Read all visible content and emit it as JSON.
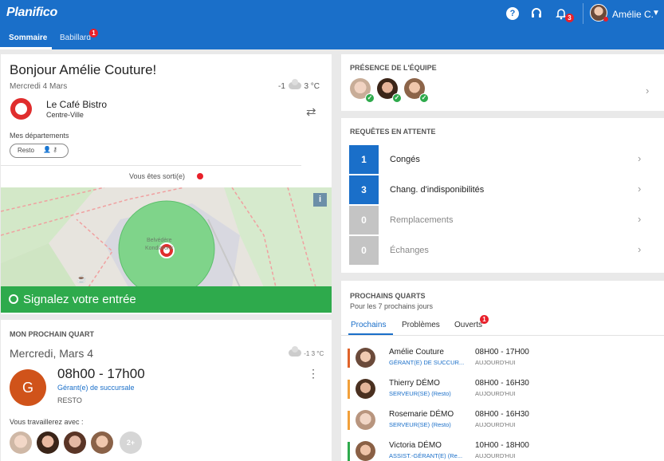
{
  "app": {
    "logo": "Planifico"
  },
  "topbar": {
    "help_glyph": "?",
    "notifications_count": "3",
    "user_name": "Amélie C."
  },
  "tabs": [
    {
      "label": "Sommaire",
      "active": true
    },
    {
      "label": "Babillard",
      "badge": "1"
    }
  ],
  "greeting": {
    "title": "Bonjour Amélie Couture!",
    "date": "Mercredi 4 Mars",
    "weather_low": "-1",
    "weather_high": "3 °C",
    "place_name": "Le Café Bistro",
    "place_sub": "Centre-Ville",
    "departments_label": "Mes départements",
    "department": "Resto",
    "status_text": "Vous êtes sorti(e)",
    "map_label": "Belvédère Kondiaronk",
    "checkin_label": "Signalez votre entrée"
  },
  "next_shift": {
    "section_title": "MON PROCHAIN QUART",
    "date": "Mercredi, Mars 4",
    "weather_high": "-1",
    "weather_unit": "°C",
    "weather_low": "3",
    "avatar_letter": "G",
    "time": "08h00 - 17h00",
    "role": "Gérant(e) de succursale",
    "department": "RESTO",
    "with_label": "Vous travaillerez avec :",
    "more": "2+"
  },
  "presence": {
    "section_title": "PRÉSENCE DE L'ÉQUIPE"
  },
  "requests": {
    "section_title": "REQUÊTES EN ATTENTE",
    "items": [
      {
        "count": "1",
        "label": "Congés"
      },
      {
        "count": "3",
        "label": "Chang. d'indisponibilités"
      },
      {
        "count": "0",
        "label": "Remplacements"
      },
      {
        "count": "0",
        "label": "Échanges"
      }
    ]
  },
  "upcoming": {
    "section_title": "PROCHAINS QUARTS",
    "subtitle": "Pour les 7 prochains jours",
    "tabs": [
      "Prochains",
      "Problèmes",
      "Ouverts"
    ],
    "open_badge": "1",
    "rows": [
      {
        "name": "Amélie Couture",
        "role": "GÉRANT(E) DE SUCCUR...",
        "time": "08H00 - 17H00",
        "when": "AUJOURD'HUI",
        "color": "#e0632a"
      },
      {
        "name": "Thierry DÉMO",
        "role": "SERVEUR(SE) (Resto)",
        "time": "08H00 - 16H30",
        "when": "AUJOURD'HUI",
        "color": "#f2a03a"
      },
      {
        "name": "Rosemarie DÉMO",
        "role": "SERVEUR(SE) (Resto)",
        "time": "08H00 - 16H30",
        "when": "AUJOURD'HUI",
        "color": "#f2a03a"
      },
      {
        "name": "Victoria DÉMO",
        "role": "ASSIST.-GÉRANT(E) (Re...",
        "time": "10H00 - 18H00",
        "when": "AUJOURD'HUI",
        "color": "#2eaa4c"
      }
    ]
  },
  "colors": {
    "brand": "#1a6fc9",
    "success": "#2eaa4c",
    "alert": "#e8202a",
    "muted_count": "#c4c4c4"
  }
}
